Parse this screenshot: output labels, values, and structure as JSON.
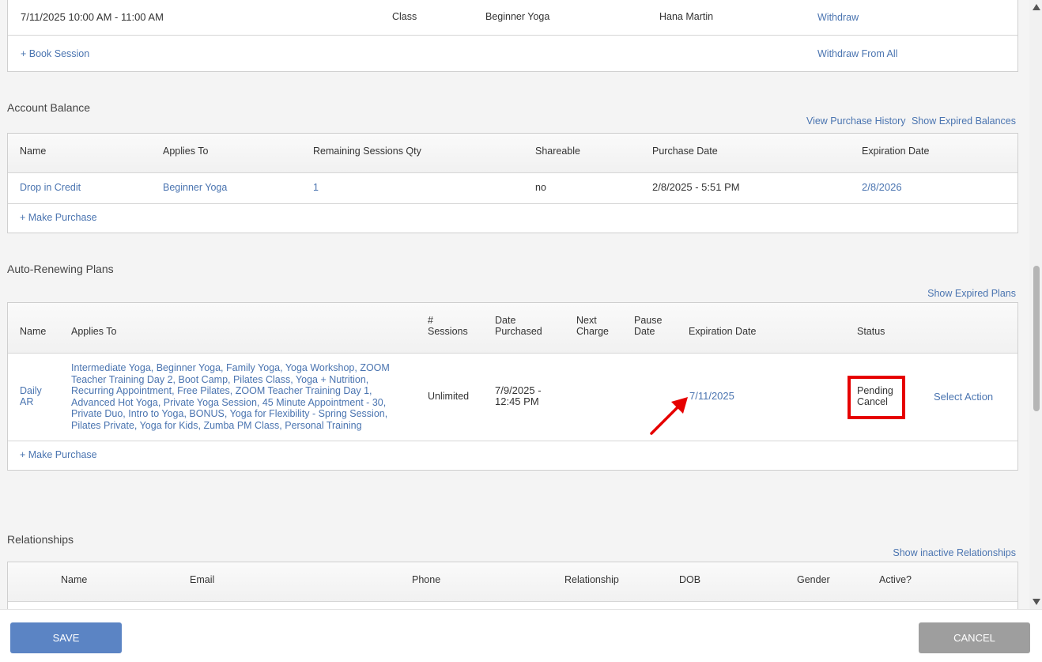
{
  "sessions": {
    "row": {
      "datetime": "7/11/2025 10:00 AM - 11:00 AM",
      "type": "Class",
      "name": "Beginner Yoga",
      "instructor": "Hana Martin",
      "action": "Withdraw"
    },
    "book_link": "+ Book Session",
    "withdraw_all": "Withdraw From All"
  },
  "account_balance": {
    "title": "Account Balance",
    "links": [
      "View Purchase History",
      "Show Expired Balances"
    ],
    "headers": [
      "Name",
      "Applies To",
      "Remaining Sessions Qty",
      "Shareable",
      "Purchase Date",
      "Expiration Date"
    ],
    "row": {
      "name": "Drop in Credit",
      "applies_to": "Beginner Yoga",
      "qty": "1",
      "shareable": "no",
      "purchase_date": "2/8/2025 - 5:51 PM",
      "expiration": "2/8/2026"
    },
    "make_purchase": "+ Make Purchase"
  },
  "plans": {
    "title": "Auto-Renewing Plans",
    "show_expired": "Show Expired Plans",
    "headers": {
      "name": "Name",
      "applies_to": "Applies To",
      "sessions": "# Sessions",
      "date_purchased": "Date Purchased",
      "next_charge": "Next Charge",
      "pause_date": "Pause Date",
      "expiration": "Expiration Date",
      "status": "Status"
    },
    "row": {
      "name": "Daily AR",
      "applies_to": "Intermediate Yoga, Beginner Yoga, Family Yoga, Yoga Workshop, ZOOM Teacher Training Day 2, Boot Camp, Pilates Class, Yoga + Nutrition, Recurring Appointment, Free Pilates, ZOOM Teacher Training Day 1, Advanced Hot Yoga, Private Yoga Session, 45 Minute Appointment - 30, Private Duo, Intro to Yoga, BONUS, Yoga for Flexibility - Spring Session, Pilates Private, Yoga for Kids, Zumba PM Class, Personal Training",
      "sessions": "Unlimited",
      "date_purchased": "7/9/2025 - 12:45 PM",
      "expiration": "7/11/2025",
      "status": "Pending Cancel",
      "action": "Select Action"
    },
    "make_purchase": "+ Make Purchase"
  },
  "relationships": {
    "title": "Relationships",
    "show_inactive": "Show inactive Relationships",
    "headers": [
      "Name",
      "Email",
      "Phone",
      "Relationship",
      "DOB",
      "Gender",
      "Active?"
    ]
  },
  "footer": {
    "save": "SAVE",
    "cancel": "CANCEL"
  },
  "colors": {
    "link": "#4a74b0",
    "save": "#5b84c4",
    "cancel": "#9e9e9e",
    "highlight": "#e60000"
  }
}
